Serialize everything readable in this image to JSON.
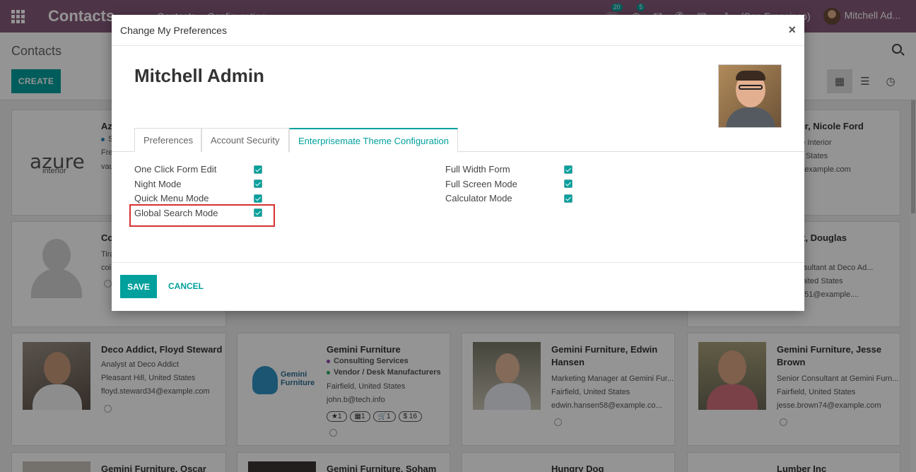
{
  "nav": {
    "brand": "Contacts",
    "menus": [
      "Contacts",
      "Configuration"
    ],
    "badges": {
      "chat": "20",
      "activity": "5"
    },
    "company": "(San Francisco)",
    "user": "Mitchell Ad..."
  },
  "control": {
    "breadcrumb": "Contacts",
    "create_label": "CREATE",
    "pager_next": "›"
  },
  "cards": [
    {
      "title": "Az",
      "lines": [
        "S",
        "Fre",
        "vau"
      ]
    },
    {
      "title": "Interior, Nicole Ford",
      "lines": [
        "at Azure Interior",
        ", United States",
        "ord75@example.com"
      ]
    },
    {
      "title": "Co",
      "lines": [
        "Tira",
        "coi"
      ]
    },
    {
      "title": "Addict, Douglas",
      "title2": "er",
      "lines": [
        "nal Consultant at Deco Ad...",
        "t Hill, United States",
        ".fletcher51@example...."
      ]
    },
    {
      "title": "Deco Addict, Floyd Steward",
      "lines": [
        "Analyst at Deco Addict",
        "Pleasant Hill, United States",
        "floyd.steward34@example.com"
      ]
    },
    {
      "title": "Gemini Furniture",
      "tags": [
        "Consulting Services",
        "Vendor / Desk Manufacturers"
      ],
      "lines": [
        "Fairfield, United States",
        "john.b@tech.info"
      ],
      "pills": [
        "★1",
        "▦1",
        "🛒1",
        "$ 16"
      ]
    },
    {
      "title": "Gemini Furniture, Edwin",
      "title2": "Hansen",
      "lines": [
        "Marketing Manager at Gemini Fur...",
        "Fairfield, United States",
        "edwin.hansen58@example.co..."
      ]
    },
    {
      "title": "Gemini Furniture, Jesse",
      "title2": "Brown",
      "lines": [
        "Senior Consultant at Gemini Furn...",
        "Fairfield, United States",
        "jesse.brown74@example.com"
      ]
    },
    {
      "title": "Gemini Furniture, Oscar"
    },
    {
      "title": "Gemini Furniture, Soham"
    },
    {
      "title": "Hungry Dog"
    },
    {
      "title": "Lumber Inc"
    }
  ],
  "logos": {
    "azure_main": "azure",
    "azure_sub": "interior",
    "gemini": "Gemini Furniture"
  },
  "modal": {
    "title": "Change My Preferences",
    "close": "×",
    "user_name": "Mitchell Admin",
    "tabs": [
      "Preferences",
      "Account Security",
      "Enterprisemate Theme Configuration"
    ],
    "active_tab": 2,
    "left_fields": [
      {
        "label": "One Click Form Edit",
        "checked": true
      },
      {
        "label": "Night Mode",
        "checked": true
      },
      {
        "label": "Quick Menu Mode",
        "checked": true
      },
      {
        "label": "Global Search Mode",
        "checked": true
      }
    ],
    "right_fields": [
      {
        "label": "Full Width Form",
        "checked": true
      },
      {
        "label": "Full Screen Mode",
        "checked": true
      },
      {
        "label": "Calculator Mode",
        "checked": true
      }
    ],
    "save": "SAVE",
    "cancel": "CANCEL"
  },
  "colors": {
    "nav": "#875a7b",
    "accent": "#00a09d",
    "highlight": "#d63131"
  }
}
